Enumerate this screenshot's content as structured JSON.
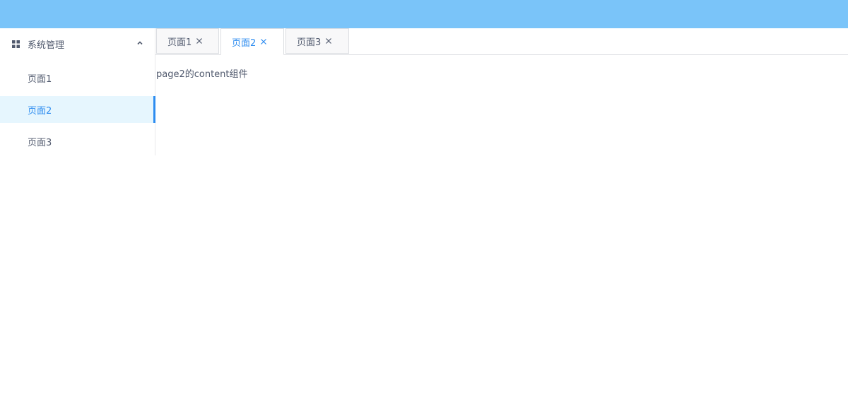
{
  "sidebar": {
    "group": {
      "label": "系统管理",
      "icon": "grid-icon",
      "toggle_icon": "chevron-up-icon"
    },
    "items": [
      {
        "label": "页面1",
        "active": false
      },
      {
        "label": "页面2",
        "active": true
      },
      {
        "label": "页面3",
        "active": false
      }
    ]
  },
  "tabs": [
    {
      "label": "页面1",
      "active": false,
      "close_icon": "close-icon"
    },
    {
      "label": "页面2",
      "active": true,
      "close_icon": "close-icon"
    },
    {
      "label": "页面3",
      "active": false,
      "close_icon": "close-icon"
    }
  ],
  "content": {
    "text": "page2的content组件"
  },
  "colors": {
    "header": "#7ac4f9",
    "accent": "#2d8cf0",
    "active_bg": "#e6f6fe"
  }
}
